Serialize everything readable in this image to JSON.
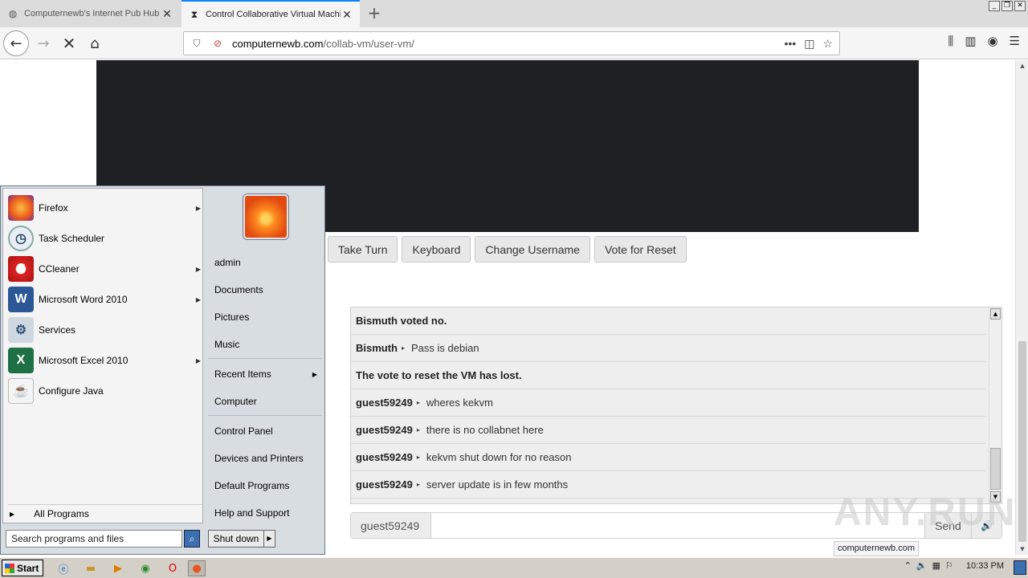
{
  "browser": {
    "tabs": [
      {
        "title": "Computernewb's Internet Pub Hub",
        "active": false
      },
      {
        "title": "Control Collaborative Virtual Machi",
        "active": true
      }
    ],
    "url_host": "computernewb.com",
    "url_path": "/collab-vm/user-vm/",
    "status_url": "computernewb.com"
  },
  "vm": {
    "buttons": [
      {
        "label": "Take Turn"
      },
      {
        "label": "Keyboard"
      },
      {
        "label": "Change Username"
      },
      {
        "label": "Vote for Reset"
      }
    ]
  },
  "chat": {
    "messages": [
      {
        "type": "system",
        "text": "Bismuth voted no."
      },
      {
        "type": "user",
        "user": "Bismuth",
        "text": "Pass is debian"
      },
      {
        "type": "system",
        "text": "The vote to reset the VM has lost."
      },
      {
        "type": "user",
        "user": "guest59249",
        "text": "wheres kekvm"
      },
      {
        "type": "user",
        "user": "guest59249",
        "text": "there is no collabnet here"
      },
      {
        "type": "user",
        "user": "guest59249",
        "text": "kekvm shut down for no reason"
      },
      {
        "type": "user",
        "user": "guest59249",
        "text": "server update is in few months"
      }
    ],
    "username": "guest59249",
    "send_label": "Send",
    "input_value": ""
  },
  "watermark": "ANY.RUN",
  "start_menu": {
    "programs": [
      {
        "label": "Firefox",
        "icon": "firefox-icon",
        "submenu": true
      },
      {
        "label": "Task Scheduler",
        "icon": "clock-icon",
        "submenu": false
      },
      {
        "label": "CCleaner",
        "icon": "ccleaner-icon",
        "submenu": true
      },
      {
        "label": "Microsoft Word 2010",
        "icon": "word-icon",
        "submenu": true
      },
      {
        "label": "Services",
        "icon": "gears-icon",
        "submenu": false
      },
      {
        "label": "Microsoft Excel 2010",
        "icon": "excel-icon",
        "submenu": true
      },
      {
        "label": "Configure Java",
        "icon": "java-icon",
        "submenu": false
      }
    ],
    "all_programs": "All Programs",
    "search_placeholder": "Search programs and files",
    "right_links": [
      {
        "label": "admin"
      },
      {
        "label": "Documents"
      },
      {
        "label": "Pictures"
      },
      {
        "label": "Music"
      },
      {
        "label": "Recent Items",
        "submenu": true
      },
      {
        "label": "Computer"
      },
      {
        "label": "Control Panel"
      },
      {
        "label": "Devices and Printers"
      },
      {
        "label": "Default Programs"
      },
      {
        "label": "Help and Support"
      }
    ],
    "shutdown": "Shut down"
  },
  "taskbar": {
    "start_label": "Start",
    "clock": "10:33 PM"
  }
}
